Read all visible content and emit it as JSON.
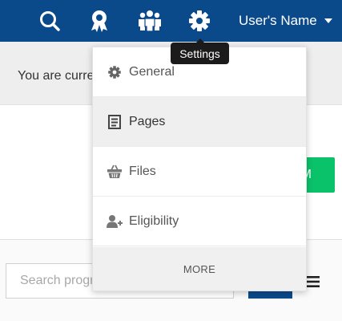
{
  "header": {
    "user_name": "User's Name",
    "icons": [
      "search-icon",
      "award-icon",
      "users-group-icon",
      "gear-icon"
    ],
    "tooltip": "Settings"
  },
  "notice": {
    "text": "You are currently"
  },
  "action": {
    "label": "M"
  },
  "search": {
    "placeholder": "Search programs"
  },
  "settings_menu": {
    "items": [
      {
        "label": "General",
        "icon": "gear-icon"
      },
      {
        "label": "Pages",
        "icon": "page-icon"
      },
      {
        "label": "Files",
        "icon": "basket-icon"
      },
      {
        "label": "Eligibility",
        "icon": "user-plus-icon"
      }
    ],
    "more_label": "MORE",
    "active_item": "Pages"
  },
  "colors": {
    "nav_bg": "#0b4a8a",
    "accent_green": "#0ac26a",
    "tooltip_bg": "#1b1b1b"
  }
}
